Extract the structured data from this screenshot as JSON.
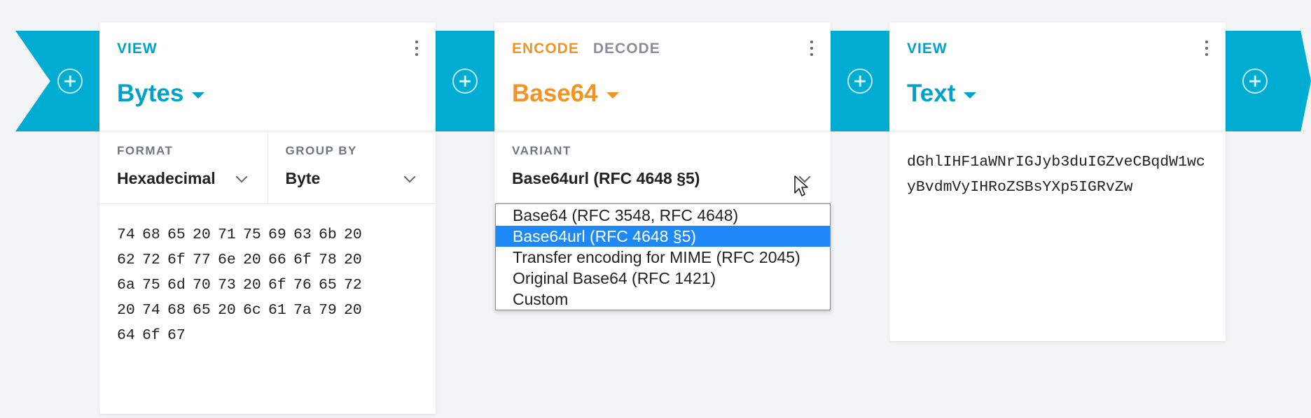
{
  "pipeline": {
    "add_buttons": [
      "add-operation",
      "add-operation",
      "add-operation",
      "add-operation"
    ]
  },
  "card1": {
    "tabs": [
      "VIEW"
    ],
    "title": "Bytes",
    "settings": [
      {
        "label": "FORMAT",
        "value": "Hexadecimal"
      },
      {
        "label": "GROUP BY",
        "value": "Byte"
      }
    ],
    "bytes": [
      "74",
      "68",
      "65",
      "20",
      "71",
      "75",
      "69",
      "63",
      "6b",
      "20",
      "62",
      "72",
      "6f",
      "77",
      "6e",
      "20",
      "66",
      "6f",
      "78",
      "20",
      "6a",
      "75",
      "6d",
      "70",
      "73",
      "20",
      "6f",
      "76",
      "65",
      "72",
      "20",
      "74",
      "68",
      "65",
      "20",
      "6c",
      "61",
      "7a",
      "79",
      "20",
      "64",
      "6f",
      "67"
    ]
  },
  "card2": {
    "tabs": [
      "ENCODE",
      "DECODE"
    ],
    "title": "Base64",
    "settings": [
      {
        "label": "VARIANT",
        "value": "Base64url (RFC 4648 §5)"
      }
    ],
    "dropdown": {
      "options": [
        "Base64 (RFC 3548, RFC 4648)",
        "Base64url (RFC 4648 §5)",
        "Transfer encoding for MIME (RFC 2045)",
        "Original Base64 (RFC 1421)",
        "Custom"
      ],
      "selected_index": 1
    }
  },
  "card3": {
    "tabs": [
      "VIEW"
    ],
    "title": "Text",
    "content": "dGhlIHF1aWNrIGJyb3duIGZveCBqdW1wcyBvdmVyIHRoZSBsYXp5IGRvZw"
  },
  "colors": {
    "pipe": "#00acd1",
    "view_accent": "#00a2c9",
    "encode_accent": "#f39322",
    "selected_option": "#1e88f7"
  }
}
